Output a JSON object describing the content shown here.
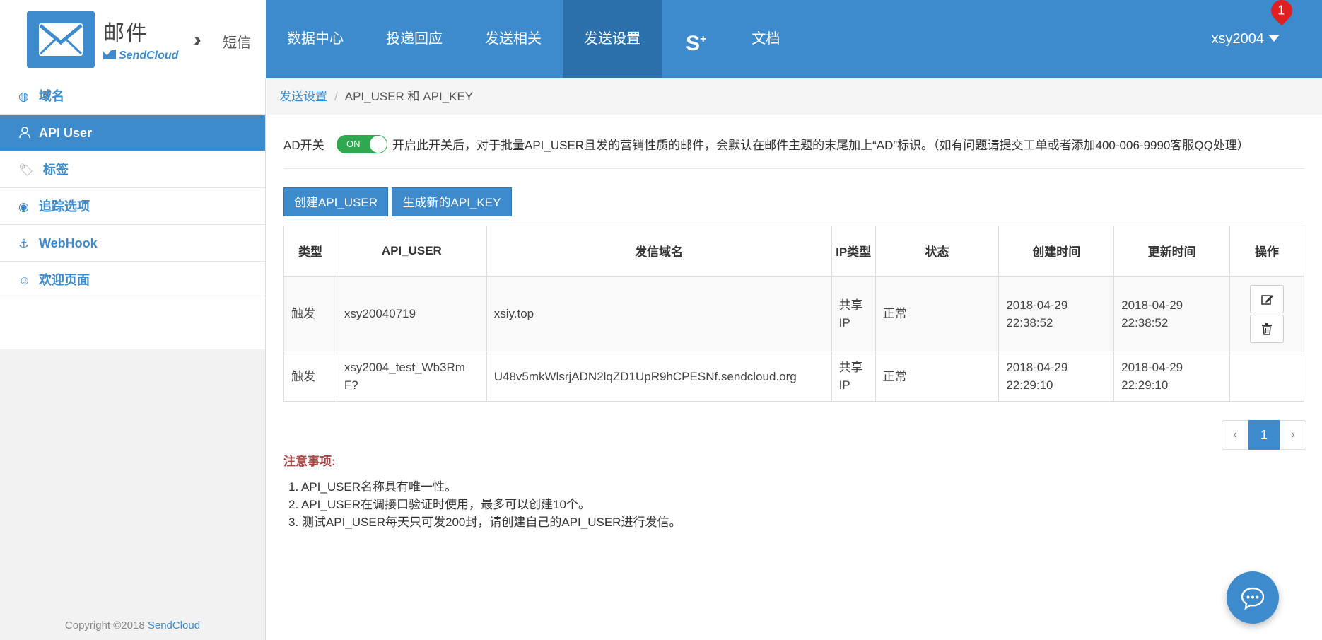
{
  "brand": {
    "title": "邮件",
    "subtitle": "SendCloud",
    "switch_label": "短信"
  },
  "nav": {
    "items": [
      "数据中心",
      "投递回应",
      "发送相关",
      "发送设置",
      "S",
      "文档"
    ],
    "active": "发送设置"
  },
  "user": {
    "name": "xsy2004",
    "badge": "1"
  },
  "sidebar": {
    "items": [
      {
        "label": "域名",
        "icon": "globe-icon"
      },
      {
        "label": "API User",
        "icon": "user-icon"
      },
      {
        "label": "标签",
        "icon": "tag-icon"
      },
      {
        "label": "追踪选项",
        "icon": "eye-icon"
      },
      {
        "label": "WebHook",
        "icon": "anchor-icon"
      },
      {
        "label": "欢迎页面",
        "icon": "smile-icon"
      }
    ],
    "active": "API User",
    "copyright_prefix": "Copyright ©2018",
    "copyright_link": "SendCloud"
  },
  "breadcrumb": {
    "parent": "发送设置",
    "sep": "/",
    "current": "API_USER 和 API_KEY"
  },
  "ad": {
    "label": "AD开关",
    "toggle": "ON",
    "description": "开启此开关后，对于批量API_USER且发的营销性质的邮件，会默认在邮件主题的末尾加上“AD”标识。（如有问题请提交工单或者添加400-006-9990客服QQ处理）"
  },
  "buttons": {
    "create": "创建API_USER",
    "generate": "生成新的API_KEY"
  },
  "table": {
    "headers": [
      "类型",
      "API_USER",
      "发信域名",
      "IP类型",
      "状态",
      "创建时间",
      "更新时间",
      "操作"
    ],
    "rows": [
      {
        "type": "触发",
        "api_user": "xsy20040719",
        "domain": "xsiy.top",
        "ip": "共享IP",
        "status": "正常",
        "created": "2018-04-29 22:38:52",
        "updated": "2018-04-29 22:38:52"
      },
      {
        "type": "触发",
        "api_user": "xsy2004_test_Wb3RmF?",
        "domain": "U48v5mkWlsrjADN2lqZD1UpR9hCPESNf.sendcloud.org",
        "ip": "共享IP",
        "status": "正常",
        "created": "2018-04-29 22:29:10",
        "updated": "2018-04-29 22:29:10"
      }
    ]
  },
  "pager": {
    "prev": "‹",
    "current": "1",
    "next": "›"
  },
  "notes": {
    "title": "注意事项:",
    "items": [
      "1. API_USER名称具有唯一性。",
      "2. API_USER在调接口验证时使用，最多可以创建10个。",
      "3. 测试API_USER每天只可发200封，请创建自己的API_USER进行发信。"
    ]
  },
  "colors": {
    "primary": "#3d8bcd",
    "nav_active": "#2b6fab",
    "toggle_on": "#2fa84f",
    "badge": "#e02020",
    "notes_title": "#a94442"
  }
}
